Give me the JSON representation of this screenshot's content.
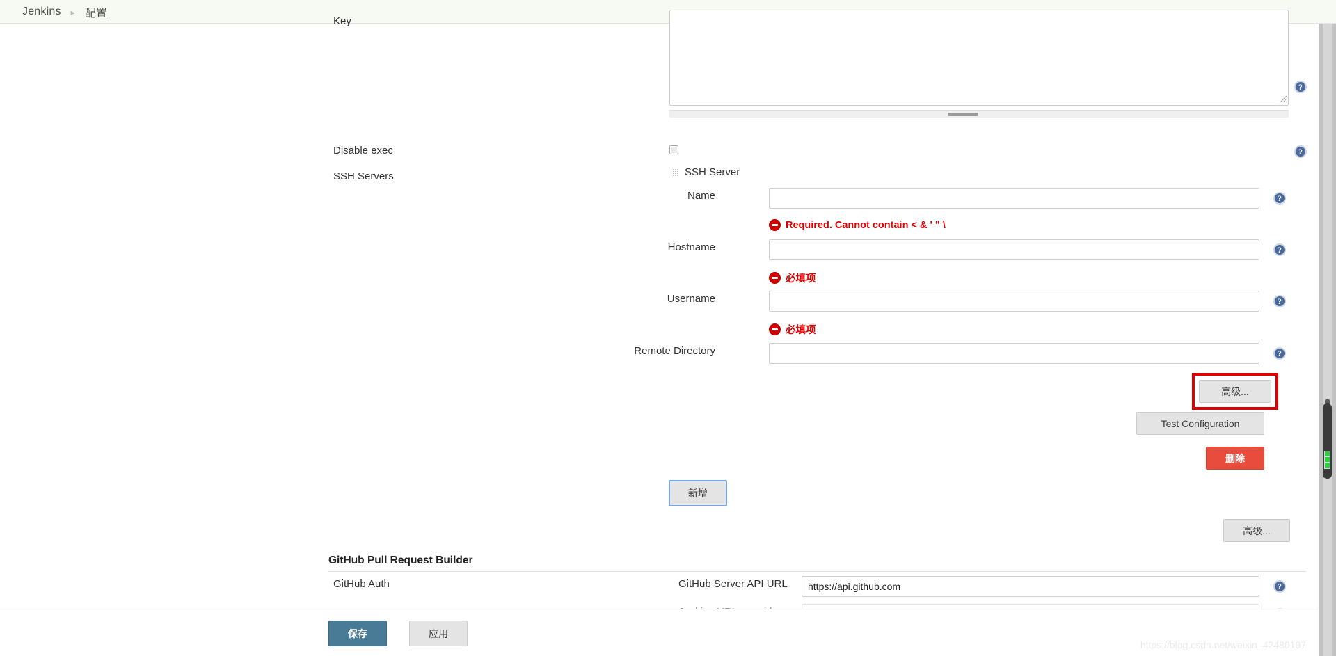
{
  "breadcrumb": {
    "root": "Jenkins",
    "separator": "▸",
    "current": "配置"
  },
  "key_section": {
    "label": "Key",
    "textarea_value": "",
    "help_icon": "help-icon"
  },
  "disable_exec": {
    "label": "Disable exec",
    "checked": false,
    "help_icon": "help-icon"
  },
  "ssh_servers": {
    "label": "SSH Servers",
    "panel_title": "SSH Server",
    "grip_icon": "drag-grip-icon",
    "fields": [
      {
        "label": "Name",
        "value": "",
        "error": "Required. Cannot contain < & ' \" \\"
      },
      {
        "label": "Hostname",
        "value": "",
        "error": "必填项"
      },
      {
        "label": "Username",
        "value": "",
        "error": "必填项"
      },
      {
        "label": "Remote Directory",
        "value": "",
        "error": ""
      }
    ],
    "advanced_button": "高级...",
    "test_configuration_button": "Test Configuration",
    "delete_button": "删除",
    "add_button": "新增",
    "outer_advanced_button": "高级..."
  },
  "github_prb": {
    "section_title": "GitHub Pull Request Builder",
    "auth_label": "GitHub Auth",
    "api_url_label": "GitHub Server API URL",
    "api_url_value": "https://api.github.com",
    "jenkins_url_override_label": "Jenkins URL override",
    "jenkins_url_override_value": ""
  },
  "footer": {
    "save_button": "保存",
    "apply_button": "应用"
  },
  "watermark": "https://blog.csdn.net/weixin_42480197",
  "colors": {
    "error_red": "#e00000",
    "delete_red": "#e74c3c",
    "save_teal": "#4a7b96",
    "help_blue": "#4b6a9b",
    "focus_blue": "#7aa7e0",
    "topbar_bg": "#f7f9f3"
  }
}
